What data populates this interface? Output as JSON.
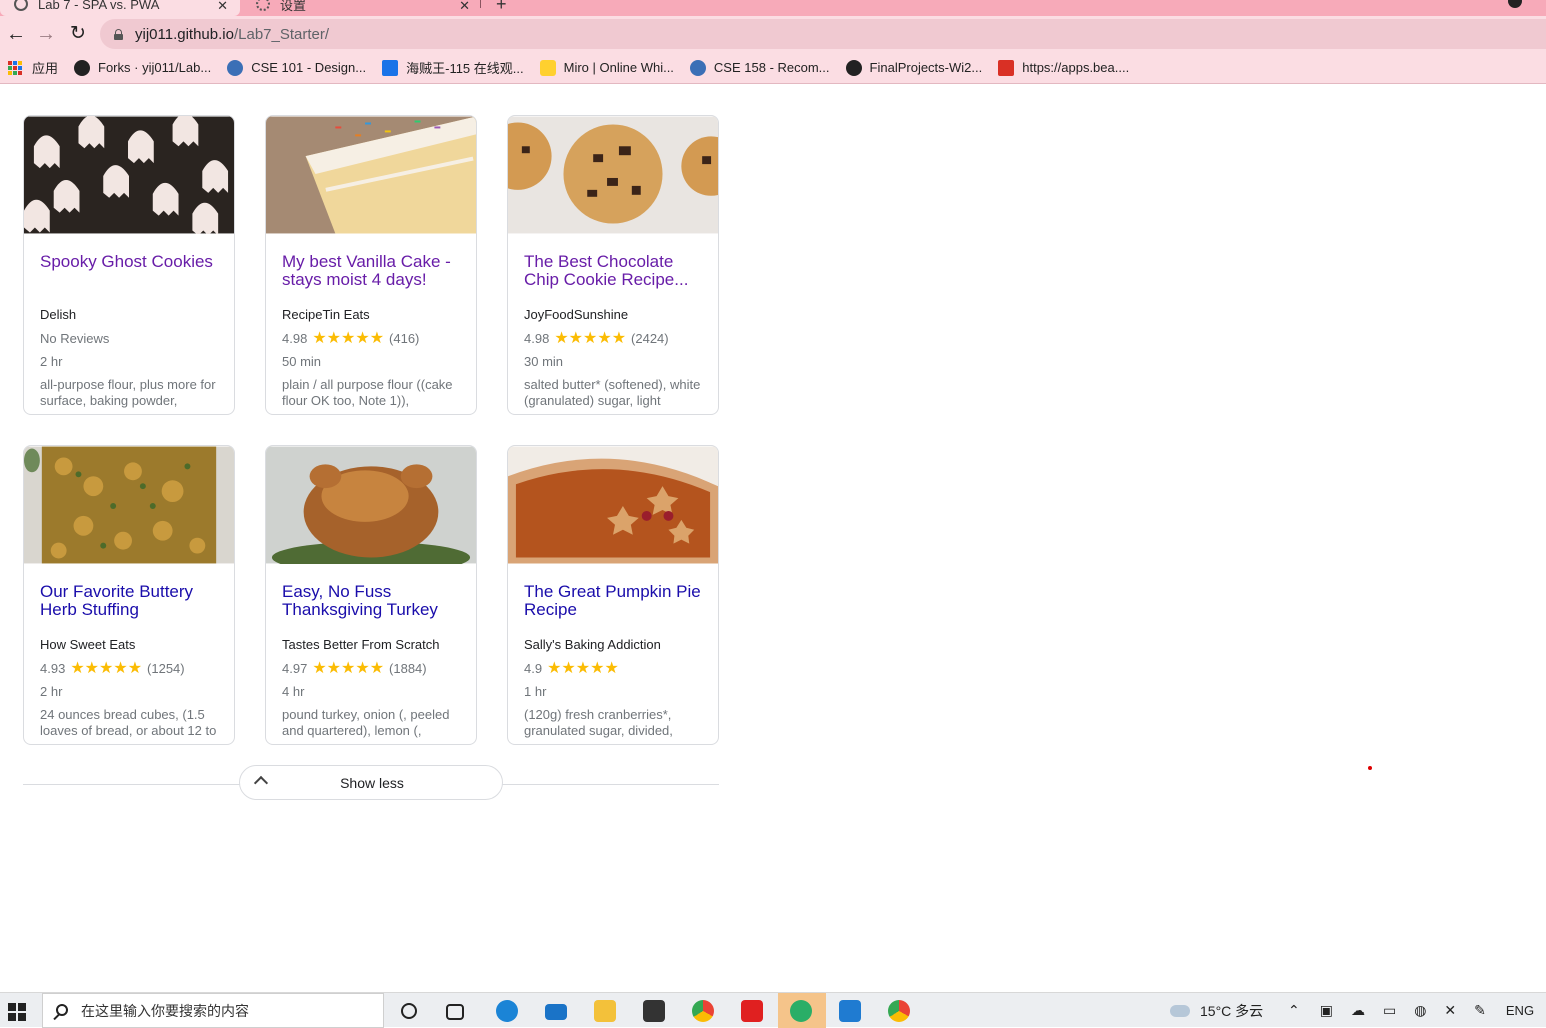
{
  "tabs": [
    {
      "title": "Lab 7 - SPA vs. PWA"
    },
    {
      "title": "设置"
    }
  ],
  "address": {
    "host": "yij011.github.io",
    "path": "/Lab7_Starter/"
  },
  "bookmarks": [
    {
      "label": "应用",
      "icon": "apps-grid-icon"
    },
    {
      "label": "Forks · yij011/Lab...",
      "icon": "github-icon"
    },
    {
      "label": "CSE 101 - Design...",
      "icon": "course-icon"
    },
    {
      "label": "海贼王-115 在线观...",
      "icon": "play-icon"
    },
    {
      "label": "Miro | Online Whi...",
      "icon": "miro-icon"
    },
    {
      "label": "CSE 158 - Recom...",
      "icon": "course-icon"
    },
    {
      "label": "FinalProjects-Wi2...",
      "icon": "github-icon"
    },
    {
      "label": "https://apps.bea....",
      "icon": "app-icon"
    }
  ],
  "recipes": [
    {
      "title": "Spooky Ghost Cookies",
      "source": "Delish",
      "rating_text": "No Reviews",
      "rating": null,
      "count": "",
      "time": "2 hr",
      "ingredients": "all-purpose flour, plus more for surface, baking powder,",
      "visited": true,
      "image_desc": "ghost cookies"
    },
    {
      "title": "My best Vanilla Cake - stays moist 4 days!",
      "source": "RecipeTin Eats",
      "rating_text": "4.98",
      "rating": 5,
      "count": "(416)",
      "time": "50 min",
      "ingredients": "plain / all purpose flour ((cake flour OK too, Note 1)),",
      "visited": true,
      "image_desc": "vanilla cake"
    },
    {
      "title": "The Best Chocolate Chip Cookie Recipe...",
      "source": "JoyFoodSunshine",
      "rating_text": "4.98",
      "rating": 5,
      "count": "(2424)",
      "time": "30 min",
      "ingredients": "salted butter* (softened), white (granulated) sugar, light",
      "visited": true,
      "image_desc": "chocolate chip cookies"
    },
    {
      "title": "Our Favorite Buttery Herb Stuffing",
      "source": "How Sweet Eats",
      "rating_text": "4.93",
      "rating": 5,
      "count": "(1254)",
      "time": "2 hr",
      "ingredients": "24 ounces bread cubes, (1.5 loaves of bread, or about 12 to",
      "visited": false,
      "image_desc": "herb stuffing"
    },
    {
      "title": "Easy, No Fuss Thanksgiving Turkey",
      "source": "Tastes Better From Scratch",
      "rating_text": "4.97",
      "rating": 5,
      "count": "(1884)",
      "time": "4 hr",
      "ingredients": "pound turkey, onion (, peeled and quartered), lemon (,",
      "visited": false,
      "image_desc": "roast turkey"
    },
    {
      "title": "The Great Pumpkin Pie Recipe",
      "source": "Sally's Baking Addiction",
      "rating_text": "4.9",
      "rating": 5,
      "count": "",
      "time": "1 hr",
      "ingredients": "(120g) fresh cranberries*, granulated sugar, divided,",
      "visited": false,
      "image_desc": "pumpkin pie"
    }
  ],
  "show_less_label": "Show less",
  "stars_text": "★★★★★",
  "taskbar": {
    "search_placeholder": "在这里输入你要搜索的内容",
    "weather": "15°C 多云",
    "language": "ENG"
  },
  "colors": {
    "tabstrip": "#f7aab9",
    "toolbar": "#fbdde3",
    "link": "#1a0dab",
    "visited_link": "#681da8",
    "star": "#fbbc04"
  }
}
